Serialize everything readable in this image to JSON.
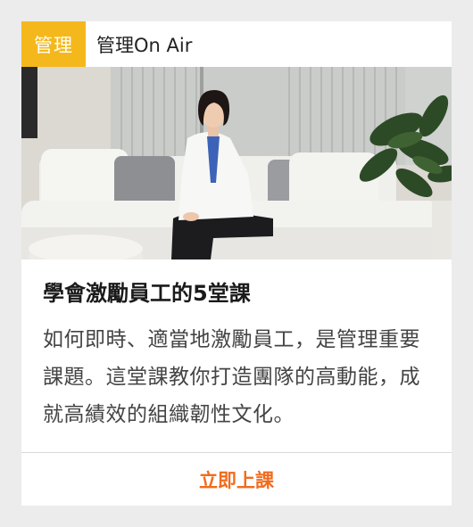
{
  "card": {
    "tag_label": "管理",
    "channel_name": "管理On Air",
    "title": "學會激勵員工的5堂課",
    "description": "如何即時、適當地激勵員工，是管理重要課題。這堂課教你打造團隊的高動能，成就高績效的組織韌性文化。",
    "cta_label": "立即上課"
  },
  "colors": {
    "tag_background": "#f5b81c",
    "cta_text": "#f26b1d"
  }
}
